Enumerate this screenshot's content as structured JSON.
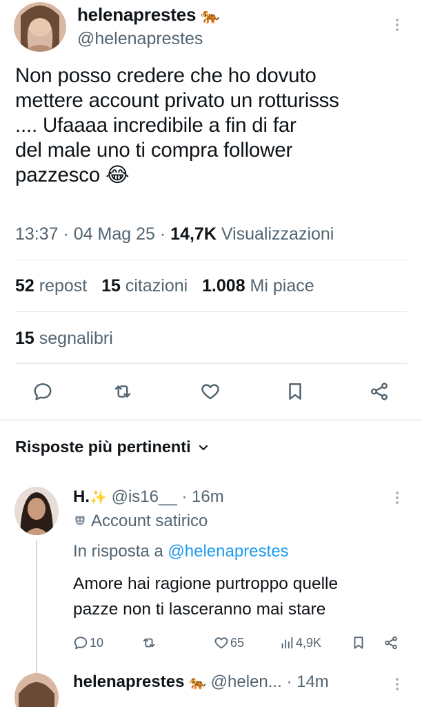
{
  "tweet": {
    "author_name": "helenaprestes",
    "author_emoji": "🐅",
    "author_handle": "@helenaprestes",
    "text": "Non posso credere che ho dovuto\nmettere account privato un rotturisss\n.... Ufaaaa incredibile a fin di far\ndel male uno ti compra follower\npazzesco 😂",
    "time": "13:37",
    "date": "04 Mag 25",
    "views_count": "14,7K",
    "views_label": "Visualizzazioni",
    "separator": "·"
  },
  "stats": {
    "reposts_count": "52",
    "reposts_label": "repost",
    "quotes_count": "15",
    "quotes_label": "citazioni",
    "likes_count": "1.008",
    "likes_label": "Mi piace",
    "bookmarks_count": "15",
    "bookmarks_label": "segnalibri"
  },
  "actions": [
    "reply-icon",
    "repost-icon",
    "like-icon",
    "bookmark-icon",
    "share-icon"
  ],
  "replies_header": {
    "label": "Risposte più pertinenti",
    "icon": "chevron-down-icon"
  },
  "reply": {
    "name": "H.",
    "name_emoji": "✨",
    "handle": "@is16__",
    "time": "· 16m",
    "label_icon": "theater-mask-icon",
    "label": "Account satirico",
    "reply_to_prefix": "In risposta a",
    "reply_to_handle": "@helenaprestes",
    "text": "Amore hai ragione purtroppo quelle\npazze non ti lasceranno mai stare",
    "comments": "10",
    "likes": "65",
    "views": "4,9K"
  },
  "next_reply": {
    "name": "helenaprestes",
    "emoji": "🐅",
    "handle": "@helen...",
    "time": "· 14m"
  },
  "colors": {
    "text": "#0f1419",
    "secondary": "#536471",
    "link": "#1d9bf0",
    "divider": "#e3e7ea"
  }
}
